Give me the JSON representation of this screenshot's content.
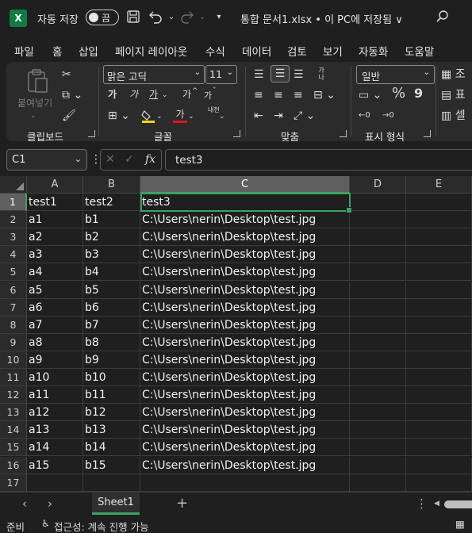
{
  "titlebar": {
    "app_icon": "excel-logo",
    "app_icon_letter": "X",
    "autosave_label": "자동 저장",
    "autosave_state": "끔",
    "doc_title": "통합 문서1.xlsx • 이 PC에 저장됨 ∨",
    "icons": [
      "save-icon",
      "undo-icon",
      "redo-icon",
      "customize-qat-icon",
      "search-icon"
    ]
  },
  "menu": {
    "tabs": [
      "파일",
      "홈",
      "삽입",
      "페이지 레이아웃",
      "수식",
      "데이터",
      "검토",
      "보기",
      "자동화",
      "도움말"
    ],
    "active": "홈"
  },
  "ribbon": {
    "clipboard": {
      "label": "클립보드",
      "paste": "붙여넣기"
    },
    "font": {
      "label": "글꼴",
      "font_name": "맑은 고딕",
      "font_size": "11",
      "bold": "가",
      "italic": "가",
      "underline": "가",
      "grow": "가",
      "shrink": "가",
      "font_color_char": "가",
      "phonetic": "내천"
    },
    "alignment": {
      "label": "맞춤",
      "wrap": "가나"
    },
    "number": {
      "label": "표시 형식",
      "format": "일반",
      "percent": "%",
      "comma": "9"
    },
    "styles": {
      "cond": "조",
      "table": "표",
      "cell": "셀"
    },
    "accent_color": "#107c41",
    "font_color": "#e81123",
    "highlight_color": "#ffd500"
  },
  "formula_bar": {
    "name_box": "C1",
    "content": "test3",
    "fx": "fx"
  },
  "sheet": {
    "columns": [
      "A",
      "B",
      "C",
      "D",
      "E"
    ],
    "selected_column": "C",
    "selected_row": "1",
    "rows": [
      {
        "n": "1",
        "cells": [
          "test1",
          "test2",
          "test3"
        ]
      },
      {
        "n": "2",
        "cells": [
          "a1",
          "b1",
          "C:\\Users\\nerin\\Desktop\\test.jpg"
        ]
      },
      {
        "n": "3",
        "cells": [
          "a2",
          "b2",
          "C:\\Users\\nerin\\Desktop\\test.jpg"
        ]
      },
      {
        "n": "4",
        "cells": [
          "a3",
          "b3",
          "C:\\Users\\nerin\\Desktop\\test.jpg"
        ]
      },
      {
        "n": "5",
        "cells": [
          "a4",
          "b4",
          "C:\\Users\\nerin\\Desktop\\test.jpg"
        ]
      },
      {
        "n": "6",
        "cells": [
          "a5",
          "b5",
          "C:\\Users\\nerin\\Desktop\\test.jpg"
        ]
      },
      {
        "n": "7",
        "cells": [
          "a6",
          "b6",
          "C:\\Users\\nerin\\Desktop\\test.jpg"
        ]
      },
      {
        "n": "8",
        "cells": [
          "a7",
          "b7",
          "C:\\Users\\nerin\\Desktop\\test.jpg"
        ]
      },
      {
        "n": "9",
        "cells": [
          "a8",
          "b8",
          "C:\\Users\\nerin\\Desktop\\test.jpg"
        ]
      },
      {
        "n": "10",
        "cells": [
          "a9",
          "b9",
          "C:\\Users\\nerin\\Desktop\\test.jpg"
        ]
      },
      {
        "n": "11",
        "cells": [
          "a10",
          "b10",
          "C:\\Users\\nerin\\Desktop\\test.jpg"
        ]
      },
      {
        "n": "12",
        "cells": [
          "a11",
          "b11",
          "C:\\Users\\nerin\\Desktop\\test.jpg"
        ]
      },
      {
        "n": "13",
        "cells": [
          "a12",
          "b12",
          "C:\\Users\\nerin\\Desktop\\test.jpg"
        ]
      },
      {
        "n": "14",
        "cells": [
          "a13",
          "b13",
          "C:\\Users\\nerin\\Desktop\\test.jpg"
        ]
      },
      {
        "n": "15",
        "cells": [
          "a14",
          "b14",
          "C:\\Users\\nerin\\Desktop\\test.jpg"
        ]
      },
      {
        "n": "16",
        "cells": [
          "a15",
          "b15",
          "C:\\Users\\nerin\\Desktop\\test.jpg"
        ]
      },
      {
        "n": "17",
        "cells": [
          "",
          "",
          ""
        ]
      }
    ]
  },
  "sheet_tabs": {
    "tabs": [
      "Sheet1"
    ],
    "add": "+"
  },
  "status": {
    "ready": "준비",
    "accessibility": "접근성: 계속 진행 가능"
  }
}
